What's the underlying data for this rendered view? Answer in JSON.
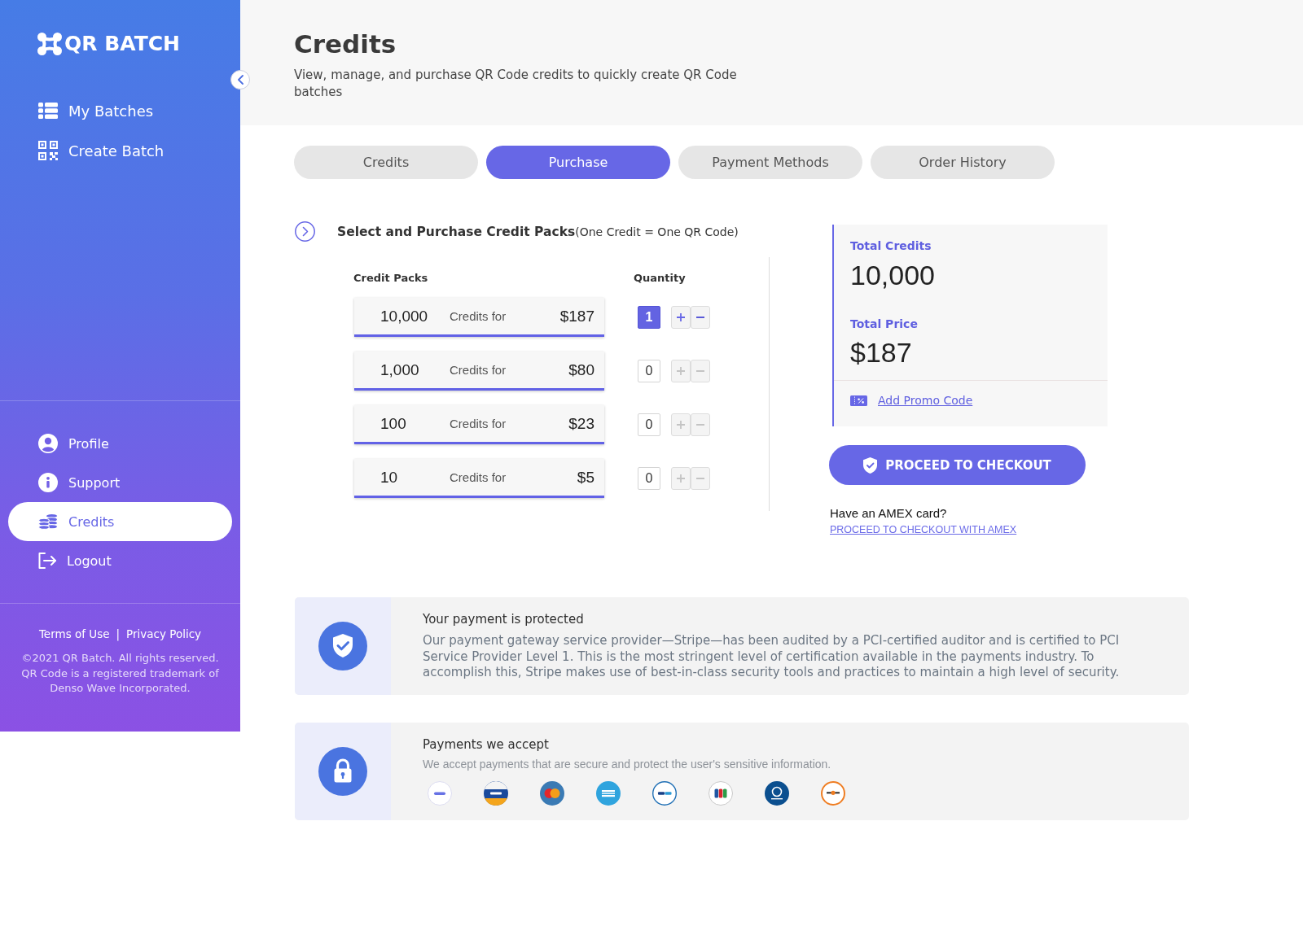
{
  "sidebar": {
    "brand": "QR BATCH",
    "nav": [
      {
        "label": "My Batches",
        "selected": false
      },
      {
        "label": "Create Batch",
        "selected": false
      }
    ],
    "account_nav": [
      {
        "label": "Profile",
        "selected": false
      },
      {
        "label": "Support",
        "selected": false
      },
      {
        "label": "Credits",
        "selected": true
      },
      {
        "label": "Logout",
        "selected": false
      }
    ],
    "footer": {
      "links": [
        "Terms of Use",
        "Privacy Policy"
      ],
      "separator": "|",
      "copyright": "©2021 QR Batch. All rights reserved. QR Code is a registered trademark of Denso Wave Incorporated."
    }
  },
  "header": {
    "title": "Credits",
    "subtitle": "View, manage, and purchase QR Code credits to quickly create QR Code batches"
  },
  "tabs": [
    {
      "label": "Credits",
      "selected": false
    },
    {
      "label": "Purchase",
      "selected": true
    },
    {
      "label": "Payment Methods",
      "selected": false
    },
    {
      "label": "Order History",
      "selected": false
    }
  ],
  "purchase": {
    "title": "Select and Purchase Credit Packs",
    "note": "(One Credit = One QR Code)",
    "columns": [
      "Credit Packs",
      "Quantity"
    ],
    "packs": [
      {
        "credits": "10,000",
        "label": "Credits for",
        "price": "$187",
        "quantity": "1",
        "selected": true
      },
      {
        "credits": "1,000",
        "label": "Credits for",
        "price": "$80",
        "quantity": "0",
        "selected": false
      },
      {
        "credits": "100",
        "label": "Credits for",
        "price": "$23",
        "quantity": "0",
        "selected": false
      },
      {
        "credits": "10",
        "label": "Credits for",
        "price": "$5",
        "quantity": "0",
        "selected": false
      }
    ]
  },
  "summary": {
    "credits_label": "Total Credits",
    "credits": "10,000",
    "price_label": "Total Price",
    "price": "$187",
    "promo_link": "Add Promo Code"
  },
  "checkout": {
    "button": "PROCEED TO CHECKOUT",
    "amex_prompt": "Have an AMEX card?",
    "amex_link": "PROCEED TO CHECKOUT WITH AMEX"
  },
  "notices": [
    {
      "kind": "security",
      "title": "Your payment is protected",
      "text": "Our payment gateway service provider—Stripe—has been audited by a PCI-certified auditor and is certified to PCI Service Provider Level 1. This is the most stringent level of certification available in the payments industry. To accomplish this, Stripe makes use of best-in-class security tools and practices to maintain a high level of security."
    },
    {
      "kind": "payments",
      "title": "Payments we accept",
      "text": "We accept payments that are secure and protect the user's sensitive information.",
      "logos": [
        {
          "kind": "stripe"
        },
        {
          "kind": "visa"
        },
        {
          "kind": "mastercard"
        },
        {
          "kind": "amex"
        },
        {
          "kind": "paypal"
        },
        {
          "kind": "jcb"
        },
        {
          "kind": "diners"
        },
        {
          "kind": "discover"
        }
      ]
    }
  ]
}
